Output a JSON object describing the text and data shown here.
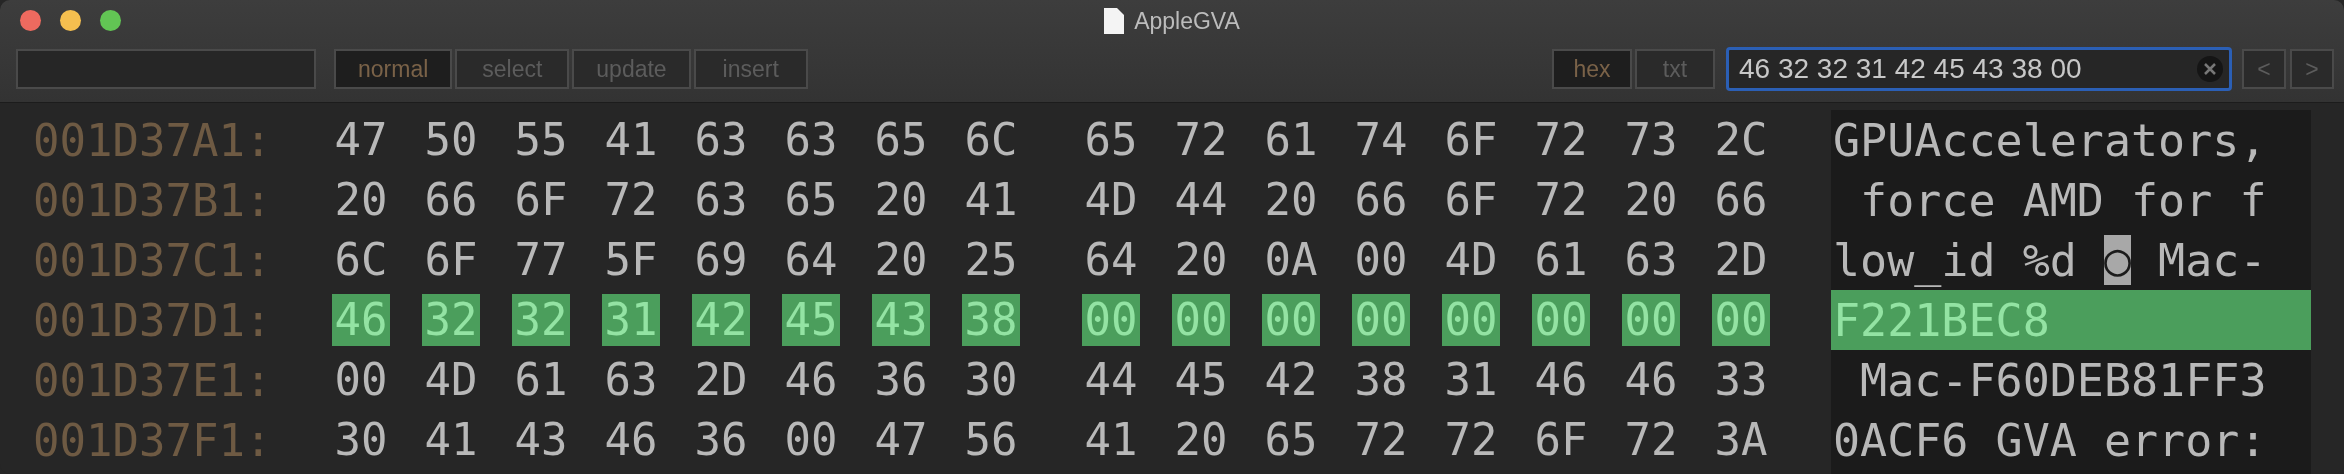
{
  "window": {
    "title": "AppleGVA"
  },
  "toolbar": {
    "modes": [
      {
        "label": "normal",
        "selected": true
      },
      {
        "label": "select",
        "selected": false
      },
      {
        "label": "update",
        "selected": false
      },
      {
        "label": "insert",
        "selected": false
      }
    ],
    "views": [
      {
        "label": "hex",
        "selected": true
      },
      {
        "label": "txt",
        "selected": false
      }
    ],
    "search": {
      "value": "46 32 32 31 42 45 43 38 00"
    },
    "nav": [
      "<",
      ">"
    ]
  },
  "rows": [
    {
      "address": "001D37A1:",
      "selected": false,
      "bytes": [
        "47",
        "50",
        "55",
        "41",
        "63",
        "63",
        "65",
        "6C",
        "65",
        "72",
        "61",
        "74",
        "6F",
        "72",
        "73",
        "2C"
      ],
      "ascii": [
        {
          "kind": "text",
          "text": "GPUAccelerators,"
        }
      ]
    },
    {
      "address": "001D37B1:",
      "selected": false,
      "bytes": [
        "20",
        "66",
        "6F",
        "72",
        "63",
        "65",
        "20",
        "41",
        "4D",
        "44",
        "20",
        "66",
        "6F",
        "72",
        "20",
        "66"
      ],
      "ascii": [
        {
          "kind": "text",
          "text": " force AMD for f"
        }
      ]
    },
    {
      "address": "001D37C1:",
      "selected": false,
      "bytes": [
        "6C",
        "6F",
        "77",
        "5F",
        "69",
        "64",
        "20",
        "25",
        "64",
        "20",
        "0A",
        "00",
        "4D",
        "61",
        "63",
        "2D"
      ],
      "ascii": [
        {
          "kind": "text",
          "text": "low_id %d "
        },
        {
          "kind": "control",
          "text": "○"
        },
        {
          "kind": "text",
          "text": " Mac-"
        }
      ]
    },
    {
      "address": "001D37D1:",
      "selected": true,
      "bytes": [
        "46",
        "32",
        "32",
        "31",
        "42",
        "45",
        "43",
        "38",
        "00",
        "00",
        "00",
        "00",
        "00",
        "00",
        "00",
        "00"
      ],
      "ascii": [
        {
          "kind": "text",
          "text": "F221BEC8"
        }
      ]
    },
    {
      "address": "001D37E1:",
      "selected": false,
      "bytes": [
        "00",
        "4D",
        "61",
        "63",
        "2D",
        "46",
        "36",
        "30",
        "44",
        "45",
        "42",
        "38",
        "31",
        "46",
        "46",
        "33"
      ],
      "ascii": [
        {
          "kind": "text",
          "text": " Mac-F60DEB81FF3"
        }
      ]
    },
    {
      "address": "001D37F1:",
      "selected": false,
      "bytes": [
        "30",
        "41",
        "43",
        "46",
        "36",
        "00",
        "47",
        "56",
        "41",
        "20",
        "65",
        "72",
        "72",
        "6F",
        "72",
        "3A"
      ],
      "ascii": [
        {
          "kind": "text",
          "text": "0ACF6 GVA error:"
        }
      ]
    }
  ]
}
